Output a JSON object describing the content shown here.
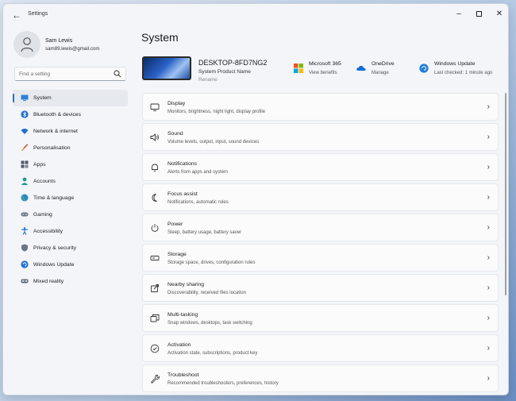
{
  "window": {
    "title": "Settings"
  },
  "profile": {
    "name": "Sam Lewis",
    "email": "sam89.lewis@gmail.com"
  },
  "search": {
    "placeholder": "Find a setting"
  },
  "sidebar": {
    "items": [
      {
        "label": "System",
        "icon": "monitor-icon",
        "active": true
      },
      {
        "label": "Bluetooth & devices",
        "icon": "bluetooth-icon"
      },
      {
        "label": "Network & internet",
        "icon": "wifi-icon"
      },
      {
        "label": "Personalisation",
        "icon": "brush-icon"
      },
      {
        "label": "Apps",
        "icon": "apps-icon"
      },
      {
        "label": "Accounts",
        "icon": "account-icon"
      },
      {
        "label": "Time & language",
        "icon": "globe-icon"
      },
      {
        "label": "Gaming",
        "icon": "gamepad-icon"
      },
      {
        "label": "Accessibility",
        "icon": "accessibility-icon"
      },
      {
        "label": "Privacy & security",
        "icon": "shield-icon"
      },
      {
        "label": "Windows Update",
        "icon": "update-icon"
      },
      {
        "label": "Mixed reality",
        "icon": "headset-icon"
      }
    ]
  },
  "main": {
    "title": "System",
    "device": {
      "name": "DESKTOP-8FD7NG2",
      "model": "System Product Name",
      "rename": "Rename"
    },
    "quick_links": [
      {
        "title": "Microsoft 365",
        "sub": "View benefits",
        "icon": "microsoft-logo-icon"
      },
      {
        "title": "OneDrive",
        "sub": "Manage",
        "icon": "cloud-icon"
      },
      {
        "title": "Windows Update",
        "sub": "Last checked: 1 minute ago",
        "icon": "update-icon"
      }
    ],
    "settings": [
      {
        "title": "Display",
        "sub": "Monitors, brightness, night light, display profile",
        "icon": "display-icon"
      },
      {
        "title": "Sound",
        "sub": "Volume levels, output, input, sound devices",
        "icon": "speaker-icon"
      },
      {
        "title": "Notifications",
        "sub": "Alerts from apps and system",
        "icon": "bell-icon"
      },
      {
        "title": "Focus assist",
        "sub": "Notifications, automatic rules",
        "icon": "moon-icon"
      },
      {
        "title": "Power",
        "sub": "Sleep, battery usage, battery saver",
        "icon": "power-icon"
      },
      {
        "title": "Storage",
        "sub": "Storage space, drives, configuration rules",
        "icon": "storage-icon"
      },
      {
        "title": "Nearby sharing",
        "sub": "Discoverability, received files location",
        "icon": "share-icon"
      },
      {
        "title": "Multi-tasking",
        "sub": "Snap windows, desktops, task switching",
        "icon": "multitask-icon"
      },
      {
        "title": "Activation",
        "sub": "Activation state, subscriptions, product key",
        "icon": "check-circle-icon"
      },
      {
        "title": "Troubleshoot",
        "sub": "Recommended troubleshooters, preferences, history",
        "icon": "wrench-icon"
      }
    ]
  },
  "colors": {
    "accent": "#2f6fc0",
    "window_bg": "#f3f5f9",
    "card_bg": "#fbfbfc"
  }
}
